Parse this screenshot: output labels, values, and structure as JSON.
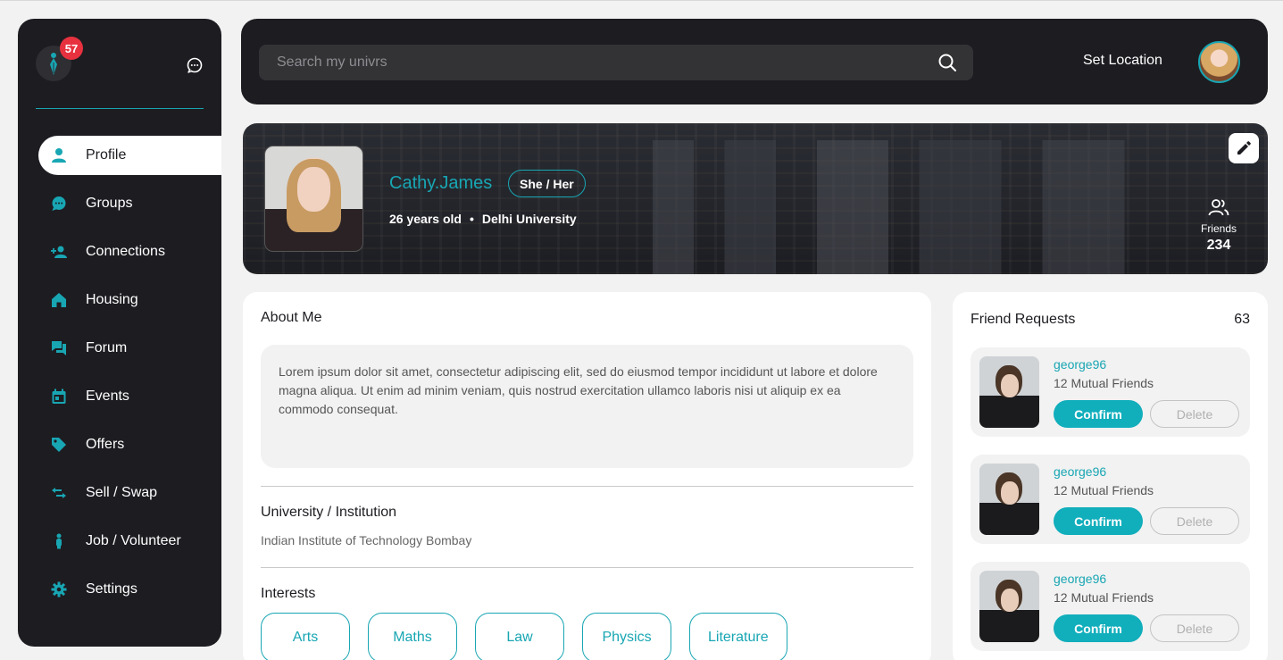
{
  "notifications": {
    "count": "57"
  },
  "nav": [
    {
      "label": "Profile",
      "icon": "person-icon",
      "active": true
    },
    {
      "label": "Groups",
      "icon": "chat-bubble-icon"
    },
    {
      "label": "Connections",
      "icon": "add-person-icon"
    },
    {
      "label": "Housing",
      "icon": "house-icon"
    },
    {
      "label": "Forum",
      "icon": "forum-icon"
    },
    {
      "label": "Events",
      "icon": "calendar-icon"
    },
    {
      "label": "Offers",
      "icon": "tag-icon"
    },
    {
      "label": "Sell / Swap",
      "icon": "swap-icon"
    },
    {
      "label": "Job / Volunteer",
      "icon": "person-standing-icon"
    },
    {
      "label": "Settings",
      "icon": "gear-icon"
    }
  ],
  "header": {
    "search_placeholder": "Search my univrs",
    "set_location": "Set Location"
  },
  "profile": {
    "name": "Cathy.James",
    "pronouns": "She / Her",
    "age": "26 years old",
    "separator": "•",
    "university": "Delhi University",
    "friends_label": "Friends",
    "friends_count": "234"
  },
  "about": {
    "title": "About Me",
    "text": "Lorem ipsum dolor sit amet, consectetur adipiscing elit, sed do eiusmod tempor incididunt ut labore et dolore magna aliqua. Ut enim ad minim veniam, quis nostrud exercitation ullamco laboris nisi ut aliquip ex ea commodo consequat.",
    "institution_title": "University / Institution",
    "institution": "Indian Institute of Technology Bombay",
    "interests_title": "Interests",
    "interests": [
      "Arts",
      "Maths",
      "Law",
      "Physics",
      "Literature"
    ]
  },
  "friend_requests": {
    "title": "Friend Requests",
    "count": "63",
    "items": [
      {
        "name": "george96",
        "mutual": "12 Mutual Friends",
        "confirm": "Confirm",
        "delete": "Delete"
      },
      {
        "name": "george96",
        "mutual": "12 Mutual Friends",
        "confirm": "Confirm",
        "delete": "Delete"
      },
      {
        "name": "george96",
        "mutual": "12 Mutual Friends",
        "confirm": "Confirm",
        "delete": "Delete"
      }
    ]
  },
  "colors": {
    "accent": "#18a6b3",
    "dark_panel": "#1d1c21",
    "badge": "#e8313f",
    "background": "#f2f2f2"
  }
}
